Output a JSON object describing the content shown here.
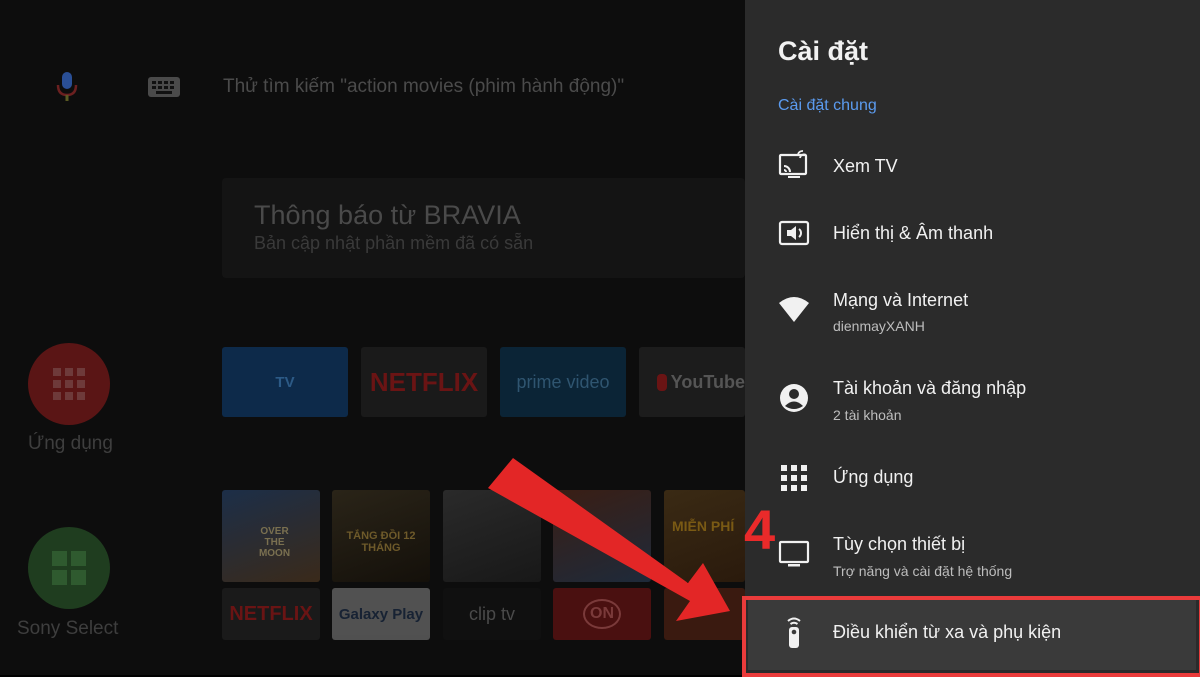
{
  "home": {
    "search_placeholder": "Thử tìm kiếm \"action movies (phim hành động)\"",
    "notification": {
      "title": "Thông báo từ BRAVIA",
      "subtitle": "Bản cập nhật phần mềm đã có sẵn"
    },
    "apps_label": "Ứng dụng",
    "sony_select_label": "Sony Select",
    "channel_tiles": [
      "TV",
      "NETFLIX",
      "prime video",
      "YouTube"
    ],
    "bottom_tiles": [
      "NETFLIX",
      "Galaxy Play",
      "clip tv",
      "ON"
    ],
    "poster_texts": [
      "OVER THE MOON",
      "TẮNG ĐỒI 12 THÁNG",
      "MIỄN PHÍ"
    ]
  },
  "panel": {
    "title": "Cài đặt",
    "section": "Cài đặt chung",
    "items": [
      {
        "label": "Xem TV",
        "sub": "",
        "icon": "tv-cast-icon"
      },
      {
        "label": "Hiển thị & Âm thanh",
        "sub": "",
        "icon": "display-sound-icon"
      },
      {
        "label": "Mạng và Internet",
        "sub": "dienmayXANH",
        "icon": "wifi-icon"
      },
      {
        "label": "Tài khoản và đăng nhập",
        "sub": "2 tài khoản",
        "icon": "account-icon"
      },
      {
        "label": "Ứng dụng",
        "sub": "",
        "icon": "apps-grid-icon"
      },
      {
        "label": "Tùy chọn thiết bị",
        "sub": "Trợ năng và cài đặt hệ thống",
        "icon": "device-icon"
      },
      {
        "label": "Điều khiển từ xa và phụ kiện",
        "sub": "",
        "icon": "remote-icon"
      }
    ]
  },
  "annotation": {
    "step": "4",
    "color": "#ea2a2a"
  }
}
